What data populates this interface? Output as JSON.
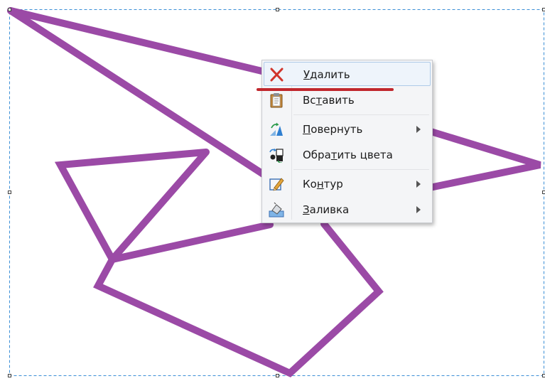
{
  "canvas": {
    "stroke_color": "#9b4aa6",
    "selection_border_color": "#3b8fd6",
    "handle_icon": "resize-handle"
  },
  "context_menu": {
    "items": [
      {
        "id": "delete",
        "label_pre": "",
        "label_ul": "У",
        "label_post": "далить",
        "icon": "delete-x-icon",
        "highlighted": true,
        "submenu": false
      },
      {
        "id": "paste",
        "label_pre": "Вс",
        "label_ul": "т",
        "label_post": "авить",
        "icon": "clipboard-paste-icon",
        "highlighted": false,
        "submenu": false
      },
      {
        "id": "rotate",
        "label_pre": "",
        "label_ul": "П",
        "label_post": "овернуть",
        "icon": "rotate-icon",
        "highlighted": false,
        "submenu": true
      },
      {
        "id": "invert",
        "label_pre": "Обра",
        "label_ul": "т",
        "label_post": "ить цвета",
        "icon": "invert-colors-icon",
        "highlighted": false,
        "submenu": false
      },
      {
        "id": "outline",
        "label_pre": "Ко",
        "label_ul": "н",
        "label_post": "тур",
        "icon": "outline-pencil-icon",
        "highlighted": false,
        "submenu": true
      },
      {
        "id": "fill",
        "label_pre": "",
        "label_ul": "З",
        "label_post": "аливка",
        "icon": "fill-bucket-icon",
        "highlighted": false,
        "submenu": true
      }
    ]
  },
  "annotation": {
    "underline_color": "#c0272d"
  }
}
